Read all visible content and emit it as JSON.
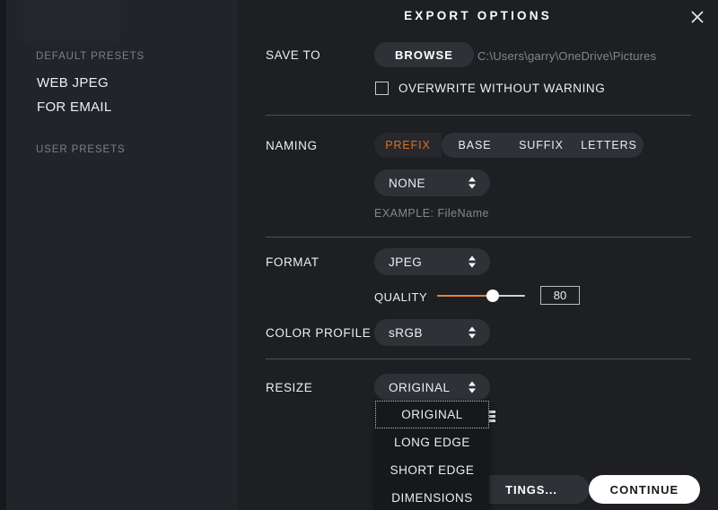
{
  "window": {
    "title": "EXPORT OPTIONS",
    "close_icon": "close-icon"
  },
  "sidebar": {
    "sections": [
      {
        "label": "DEFAULT PRESETS"
      },
      {
        "label": "USER PRESETS"
      }
    ],
    "default_presets": [
      {
        "label": "WEB JPEG"
      },
      {
        "label": "FOR EMAIL"
      }
    ],
    "user_presets": []
  },
  "save_to": {
    "label": "SAVE TO",
    "browse_label": "BROWSE",
    "path": "C:\\Users\\garry\\OneDrive\\Pictures",
    "overwrite_label": "OVERWRITE WITHOUT WARNING",
    "overwrite_checked": false
  },
  "naming": {
    "label": "NAMING",
    "tabs": [
      {
        "label": "PREFIX",
        "active": true
      },
      {
        "label": "BASE",
        "active": false
      },
      {
        "label": "SUFFIX",
        "active": false
      },
      {
        "label": "LETTERS",
        "active": false
      }
    ],
    "select_value": "NONE",
    "select_options": [
      "NONE"
    ],
    "example": "EXAMPLE: FileName"
  },
  "format": {
    "label": "FORMAT",
    "value": "JPEG",
    "options": [
      "JPEG"
    ],
    "quality_label": "QUALITY",
    "quality_value": "80",
    "quality_percent": 62
  },
  "color_profile": {
    "label": "COLOR PROFILE",
    "value": "sRGB",
    "options": [
      "sRGB"
    ]
  },
  "resize": {
    "label": "RESIZE",
    "value": "ORIGINAL",
    "dropdown_open": true,
    "options": [
      {
        "label": "ORIGINAL",
        "focused": true
      },
      {
        "label": "LONG EDGE",
        "focused": false
      },
      {
        "label": "SHORT EDGE",
        "focused": false
      },
      {
        "label": "DIMENSIONS",
        "focused": false
      }
    ]
  },
  "footer": {
    "settings_label": "TINGS...",
    "continue_label": "CONTINUE"
  },
  "colors": {
    "accent_orange": "#e2701f",
    "slider_orange": "#e8833a",
    "panel_bg": "#1d1f23",
    "sidebar_bg": "#212429",
    "control_bg": "#2e3136",
    "dropdown_bg": "#17181a",
    "text_primary": "#eceff2",
    "text_muted": "#83878c"
  }
}
